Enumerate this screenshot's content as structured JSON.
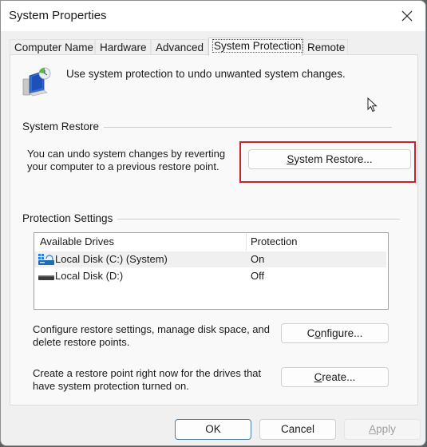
{
  "window": {
    "title": "System Properties",
    "close_icon": "close-icon"
  },
  "tabs": [
    {
      "label": "Computer Name",
      "active": false
    },
    {
      "label": "Hardware",
      "active": false
    },
    {
      "label": "Advanced",
      "active": false
    },
    {
      "label": "System Protection",
      "active": true
    },
    {
      "label": "Remote",
      "active": false
    }
  ],
  "header": {
    "icon": "system-protection-icon",
    "text": "Use system protection to undo unwanted system changes."
  },
  "system_restore": {
    "group_label": "System Restore",
    "description_line1": "You can undo system changes by reverting",
    "description_line2": "your computer to a previous restore point.",
    "button_label_accel": "S",
    "button_label_rest": "ystem Restore...",
    "highlight_color": "#c8232c"
  },
  "protection_settings": {
    "group_label": "Protection Settings",
    "columns": [
      "Available Drives",
      "Protection"
    ],
    "drives": [
      {
        "name": "Local Disk (C:) (System)",
        "protection": "On",
        "icon": "system-drive-icon",
        "selected": true
      },
      {
        "name": "Local Disk (D:)",
        "protection": "Off",
        "icon": "drive-icon",
        "selected": false
      }
    ],
    "configure": {
      "description_line1": "Configure restore settings, manage disk space, and",
      "description_line2": "delete restore points.",
      "label_pre": "C",
      "label_accel": "o",
      "label_post": "nfigure..."
    },
    "create": {
      "description_line1": "Create a restore point right now for the drives that",
      "description_line2": "have system protection turned on.",
      "label_accel": "C",
      "label_post": "reate..."
    }
  },
  "footer": {
    "ok_label": "OK",
    "cancel_label": "Cancel",
    "apply_accel": "A",
    "apply_post": "pply",
    "apply_disabled": true
  }
}
